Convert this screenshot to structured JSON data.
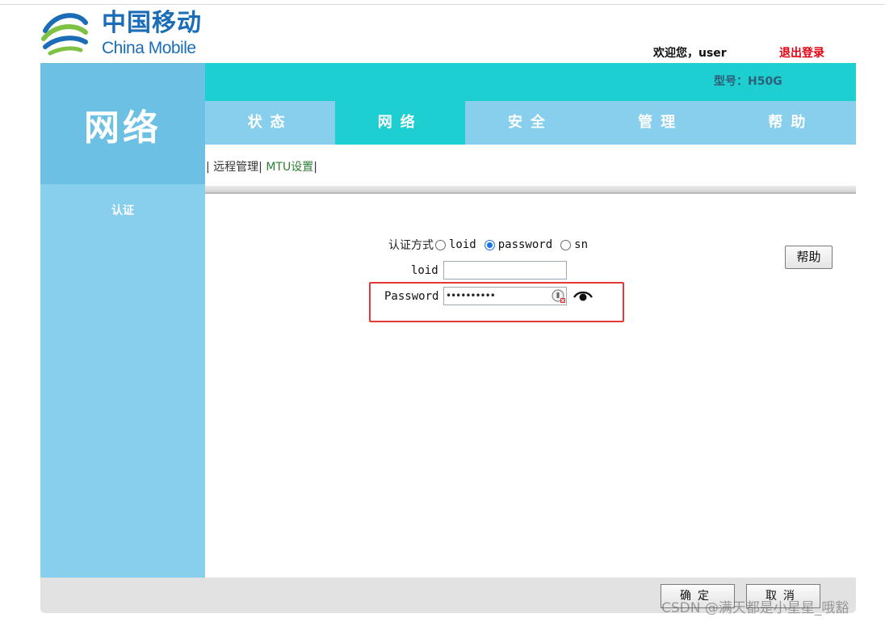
{
  "brand": {
    "name_cn": "中国移动",
    "name_en": "China Mobile"
  },
  "header": {
    "welcome": "欢迎您，user",
    "logout": "退出登录",
    "model": "型号：H50G"
  },
  "sidebar": {
    "title": "网络",
    "items": [
      {
        "label": "认证"
      }
    ]
  },
  "tabs": [
    {
      "label": "状态",
      "active": false
    },
    {
      "label": "网络",
      "active": true
    },
    {
      "label": "安全",
      "active": false
    },
    {
      "label": "管理",
      "active": false
    },
    {
      "label": "帮助",
      "active": false
    }
  ],
  "subnav": {
    "sep1": "| ",
    "remote": "远程管理",
    "sep2": "| ",
    "mtu": "MTU设置",
    "sep3": "|"
  },
  "form": {
    "auth_label": "认证方式",
    "options": [
      {
        "label": "loid",
        "checked": false
      },
      {
        "label": "password",
        "checked": true
      },
      {
        "label": "sn",
        "checked": false
      }
    ],
    "loid_label": "loid",
    "loid_value": "",
    "password_label": "Password",
    "password_mask": "••••••••••"
  },
  "buttons": {
    "help": "帮助",
    "ok": "确定",
    "cancel": "取消"
  },
  "watermark": "CSDN @满天都是小星星_哦豁",
  "colors": {
    "brand_blue": "#1b6db8",
    "teal": "#1ecfd2",
    "light_blue": "#87cfec",
    "logout_red": "#e60012",
    "highlight_red": "#e53935"
  }
}
